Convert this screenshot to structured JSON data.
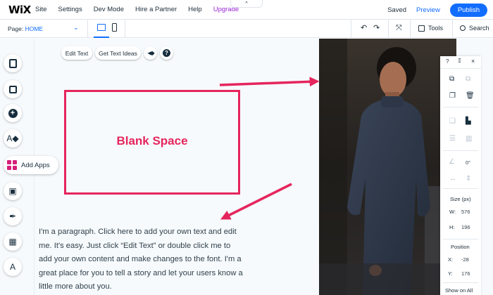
{
  "topbar": {
    "logo": "WiX",
    "menu": [
      "Site",
      "Settings",
      "Dev Mode",
      "Hire a Partner",
      "Help",
      "Upgrade"
    ],
    "collapse_glyph": "^",
    "saved": "Saved",
    "preview": "Preview",
    "publish": "Publish",
    "accent_color": "#116dff",
    "upgrade_color": "#9a27d5"
  },
  "subbar": {
    "page_prefix": "Page:",
    "page_name": "HOME",
    "page_chevron": "⌄",
    "undo": "↶",
    "redo": "↷",
    "zoom_glyph": "⤧",
    "tools": "Tools",
    "search": "Search"
  },
  "rail": {
    "items": [
      "pages-icon",
      "background-icon",
      "add-icon",
      "theme-icon",
      "media-icon",
      "blog-icon",
      "app-market-icon",
      "my-business-icon"
    ],
    "add_apps": "Add Apps"
  },
  "text_toolbar": {
    "edit_text": "Edit Text",
    "get_text_ideas": "Get Text Ideas",
    "animation_glyph": "◀◆",
    "help": "?"
  },
  "annotation": {
    "label": "Blank Space",
    "color": "#e5255d"
  },
  "paragraph": "I'm a paragraph. Click here to add your own text and edit me. It's easy. Just click “Edit Text” or double click me to add your own content and make changes to the font. I'm a great place for you to tell a story and let your users know a little more about you.",
  "panel": {
    "help": "?",
    "drag": "⁞⁞⁞",
    "close": "×",
    "rotation": "0°",
    "size_title": "Size (px)",
    "w_label": "W:",
    "w_value": "576",
    "h_label": "H:",
    "h_value": "196",
    "position_title": "Position",
    "x_label": "X:",
    "x_value": "-28",
    "y_label": "Y:",
    "y_value": "176",
    "show_on_all": "Show on All"
  }
}
